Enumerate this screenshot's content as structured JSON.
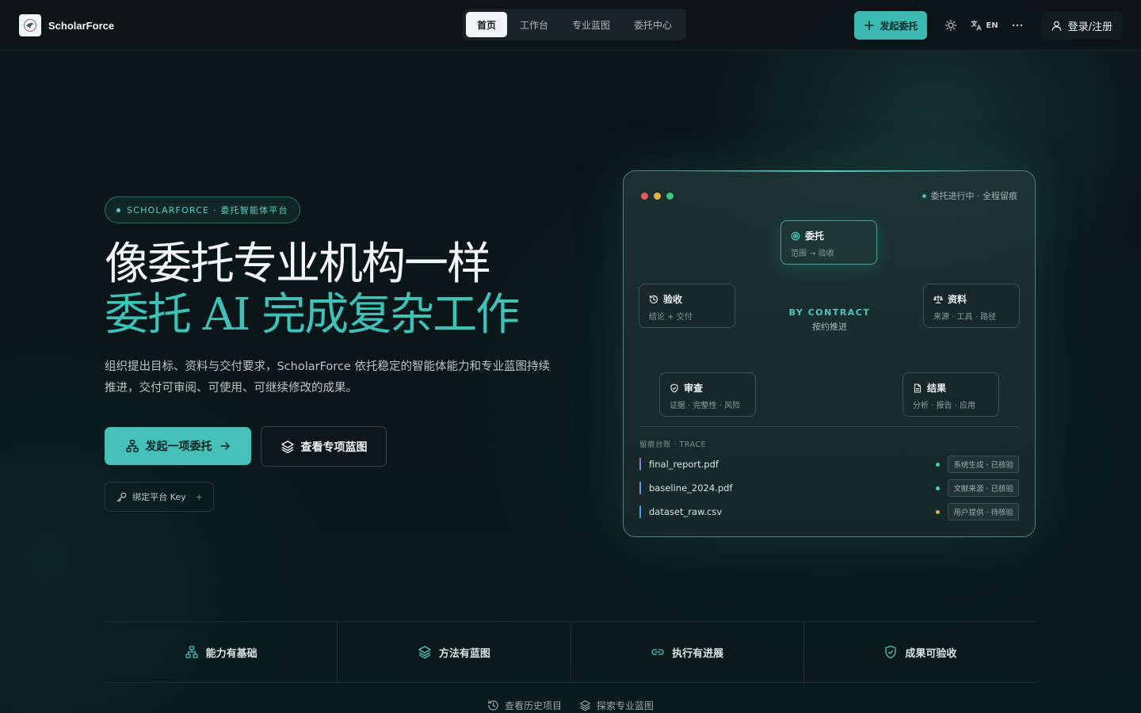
{
  "brand": {
    "name": "ScholarForce"
  },
  "nav": {
    "items": [
      {
        "label": "首页",
        "active": true
      },
      {
        "label": "工作台",
        "active": false
      },
      {
        "label": "专业蓝图",
        "active": false
      },
      {
        "label": "委托中心",
        "active": false
      }
    ]
  },
  "header": {
    "cta_label": "发起委托",
    "lang_label": "EN",
    "login_label": "登录/注册"
  },
  "hero": {
    "badge": "SCHOLARFORCE · 委托智能体平台",
    "title_line1": "像委托专业机构一样",
    "title_line2": "委托 AI 完成复杂工作",
    "description": "组织提出目标、资料与交付要求，ScholarForce 依托稳定的智能体能力和专业蓝图持续推进，交付可审阅、可使用、可继续修改的成果。",
    "primary_button": "发起一项委托",
    "secondary_button": "查看专项蓝图",
    "key_button": "绑定平台 Key",
    "key_plus": "+"
  },
  "card": {
    "status": "委托进行中 · 全程留痕",
    "nodes": {
      "commission": {
        "title": "委托",
        "sub": "范围 → 验收"
      },
      "acceptance": {
        "title": "验收",
        "sub": "结论 + 交付"
      },
      "materials": {
        "title": "资料",
        "sub": "来源 · 工具 · 路径"
      },
      "review": {
        "title": "审查",
        "sub": "证据 · 完整性 · 风险"
      },
      "result": {
        "title": "结果",
        "sub": "分析 · 报告 · 应用"
      }
    },
    "center": {
      "title": "BY CONTRACT",
      "sub": "按约推进"
    },
    "trace_label": "留痕台账 · TRACE",
    "files": [
      {
        "name": "final_report.pdf",
        "tag": "系统生成 · 已核验",
        "bar_color": "#9b7bd8",
        "dot_color": "#4fd1a5"
      },
      {
        "name": "baseline_2024.pdf",
        "tag": "文献来源 · 已核验",
        "bar_color": "#5aa0e0",
        "dot_color": "#4fd1a5"
      },
      {
        "name": "dataset_raw.csv",
        "tag": "用户提供 · 待核验",
        "bar_color": "#5aa0e0",
        "dot_color": "#e8a94a"
      }
    ]
  },
  "features": [
    {
      "label": "能力有基础",
      "icon": "network-icon"
    },
    {
      "label": "方法有蓝图",
      "icon": "layers-icon"
    },
    {
      "label": "执行有进展",
      "icon": "link-icon"
    },
    {
      "label": "成果可验收",
      "icon": "shield-check-icon"
    }
  ],
  "bottom_links": [
    {
      "label": "查看历史项目",
      "icon": "history-icon"
    },
    {
      "label": "探索专业蓝图",
      "icon": "layers-icon"
    }
  ],
  "colors": {
    "accent": "#45c1ba",
    "accent_text": "#3fc1b8",
    "background": "#0b1416"
  }
}
